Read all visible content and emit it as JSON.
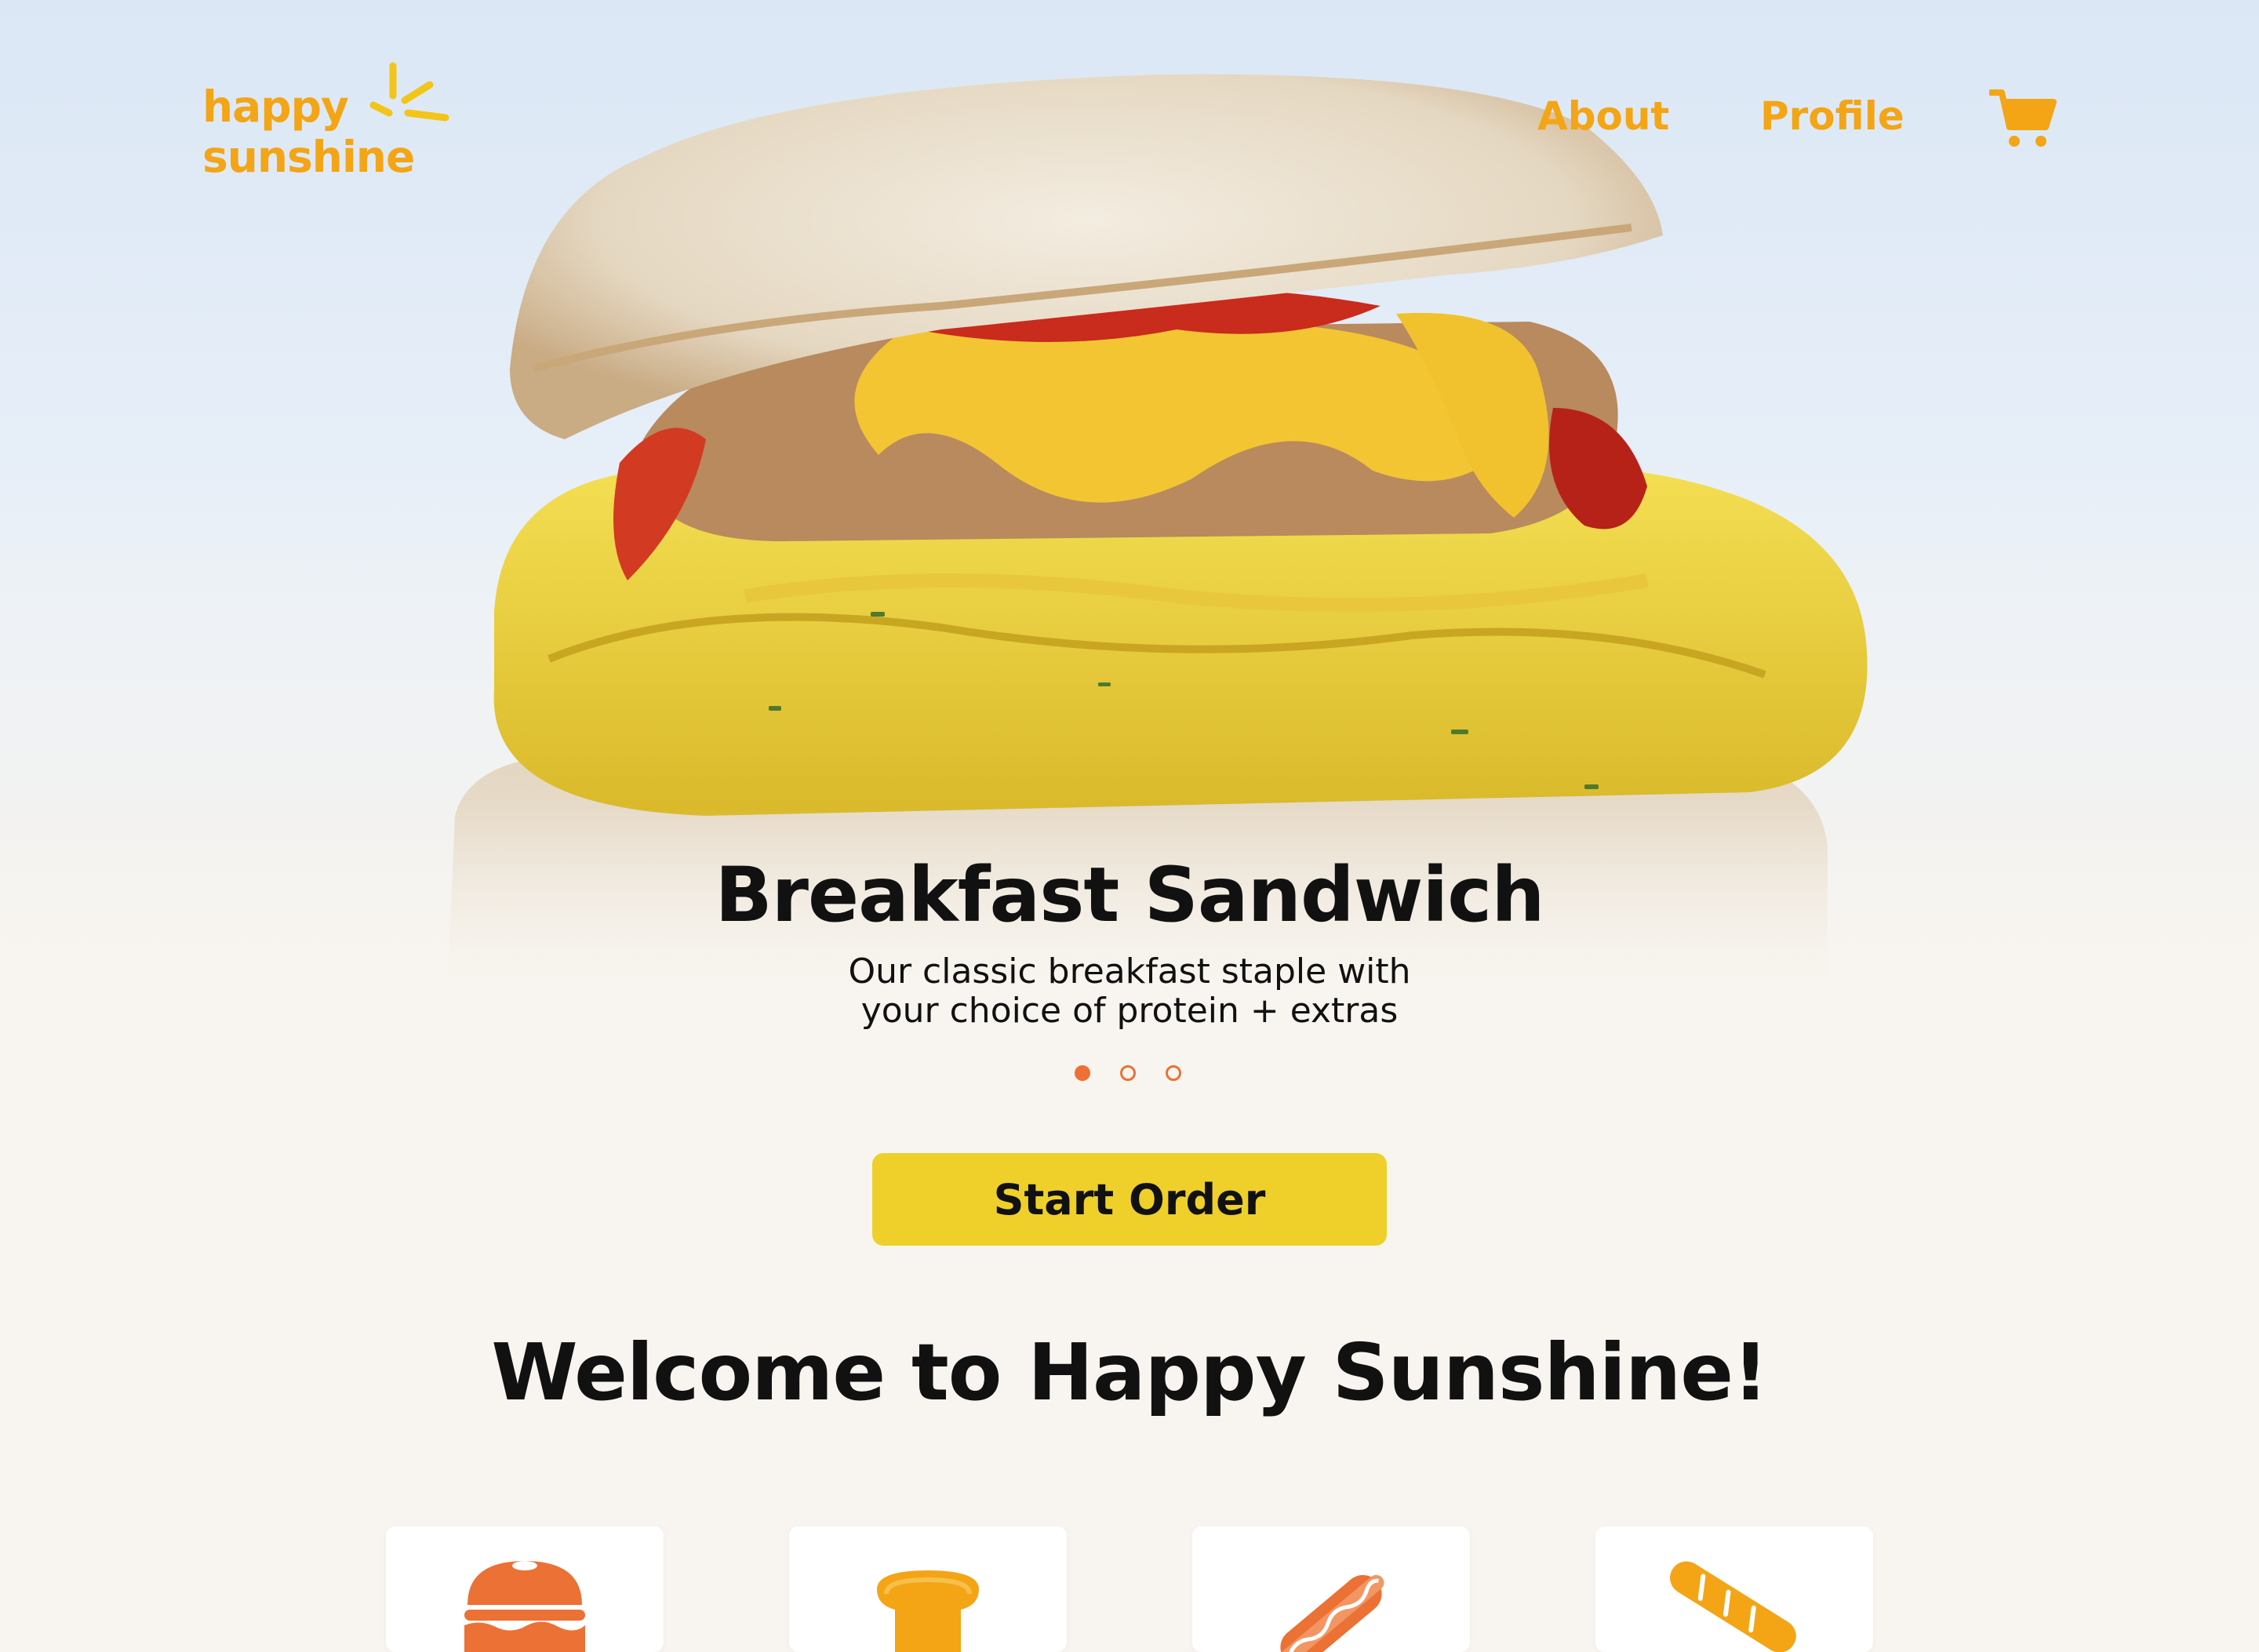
{
  "brand": {
    "logo_line1": "happy",
    "logo_line2": "sunshine",
    "color": "#f3a516"
  },
  "nav": {
    "about": "About",
    "profile": "Profile",
    "cart_icon": "cart-icon"
  },
  "hero": {
    "title": "Breakfast Sandwich",
    "description_line1": "Our classic breakfast staple with",
    "description_line2": "your choice of protein + extras",
    "slides_total": 3,
    "active_slide": 1
  },
  "cta": {
    "label": "Start Order",
    "color": "#efd02a"
  },
  "welcome": {
    "title": "Welcome to Happy Sunshine!"
  },
  "categories": [
    {
      "icon": "bagel-sandwich-icon"
    },
    {
      "icon": "toast-icon"
    },
    {
      "icon": "hot-dog-icon"
    },
    {
      "icon": "baguette-icon"
    }
  ],
  "colors": {
    "accent_orange": "#ec7134",
    "background": "#f8f5f0"
  }
}
